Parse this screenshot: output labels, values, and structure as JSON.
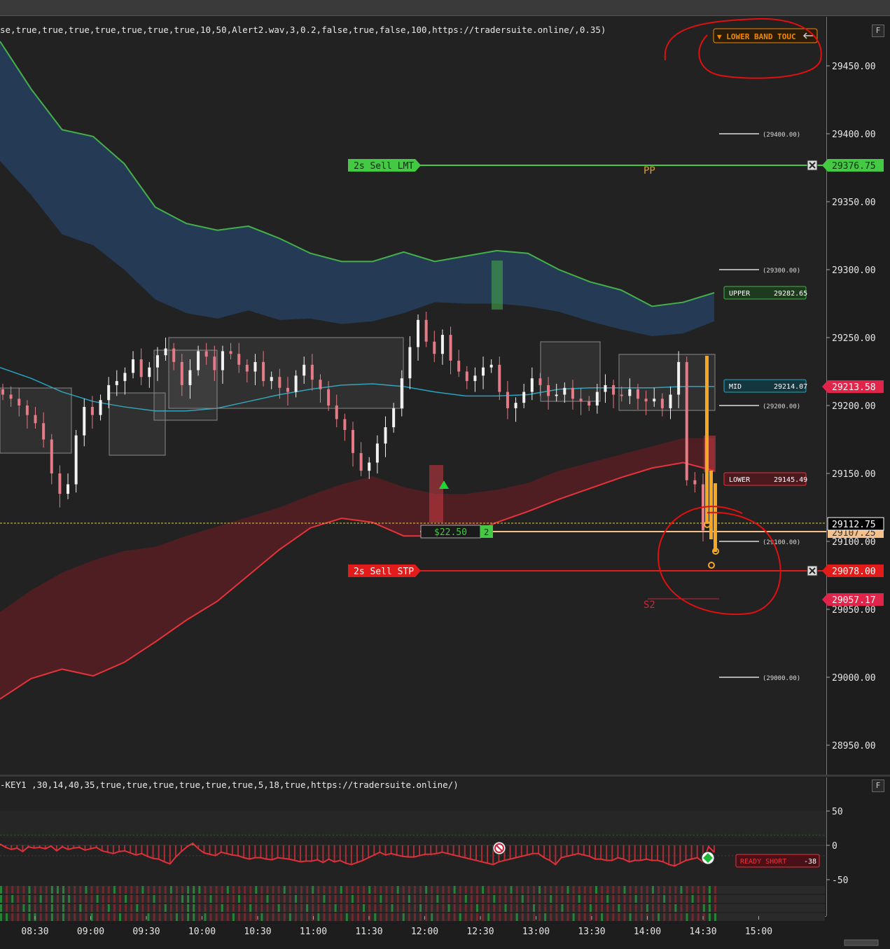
{
  "main_params": "se,true,true,true,true,true,true,true,10,50,Alert2.wav,3,0.2,false,true,false,100,https://tradersuite.online/,0.35)",
  "sub_params": "-KEY1 ,30,14,40,35,true,true,true,true,true,true,5,18,true,https://tradersuite.online/)",
  "f_label": "F",
  "alert_badge": "▼ LOWER BAND TOUC",
  "orders": {
    "sell_limit": {
      "label": "2s Sell LMT",
      "price": "29376.75"
    },
    "sell_stop": {
      "label": "2s Sell STP",
      "price": "29078.00"
    },
    "position_pnl": "$22.50",
    "position_qty": "2"
  },
  "bands": {
    "upper": {
      "label": "UPPER",
      "value": "29282.65"
    },
    "mid": {
      "label": "MID",
      "value": "29214.07"
    },
    "lower": {
      "label": "LOWER",
      "value": "29145.49"
    }
  },
  "price_flags": {
    "last": "29112.75",
    "entry": "29107.25",
    "mid_price": "29213.58",
    "s2_price": "29057.17"
  },
  "pivots": {
    "pp": "PP",
    "s2": "S2"
  },
  "ready_short": {
    "label": "READY SHORT",
    "value": "-38"
  },
  "colors": {
    "up_band": "#45b04a",
    "mid": "#25a5c0",
    "low_band": "#e8333a",
    "sell_stop": "#e21b1b",
    "sell_lmt": "#43c943",
    "entry": "#f5c08a",
    "alert": "#f08a00",
    "annot": "#e01010"
  },
  "chart_data": {
    "type": "candlestick",
    "x_ticks": [
      "08:30",
      "09:00",
      "09:30",
      "10:00",
      "10:30",
      "11:00",
      "11:30",
      "12:00",
      "12:30",
      "13:00",
      "13:30",
      "14:00",
      "14:30",
      "15:00"
    ],
    "y_ticks": [
      "29450.00",
      "29400.00",
      "29350.00",
      "29300.00",
      "29250.00",
      "29200.00",
      "29150.00",
      "29100.00",
      "29050.00",
      "29000.00",
      "28950.00"
    ],
    "ylim": [
      28926,
      29484
    ],
    "round_levels": [
      "(29400.00)",
      "(29300.00)",
      "(29200.00)",
      "(29100.00)",
      "(29000.00)"
    ],
    "sub_y_ticks": [
      "50",
      "0",
      "-50"
    ],
    "sub_ylim": [
      -72,
      72
    ],
    "upper_band": [
      [
        0,
        29468
      ],
      [
        1,
        29433
      ],
      [
        2,
        29403
      ],
      [
        3,
        29398
      ],
      [
        4,
        29378
      ],
      [
        5,
        29346
      ],
      [
        6,
        29334
      ],
      [
        7,
        29329
      ],
      [
        8,
        29332
      ],
      [
        9,
        29323
      ],
      [
        10,
        29312
      ],
      [
        11,
        29306
      ],
      [
        12,
        29306
      ],
      [
        13,
        29313
      ],
      [
        14,
        29306
      ],
      [
        15,
        29310
      ],
      [
        16,
        29314
      ],
      [
        17,
        29312
      ],
      [
        18,
        29300
      ],
      [
        19,
        29291
      ],
      [
        20,
        29285
      ],
      [
        21,
        29273
      ],
      [
        22,
        29276
      ],
      [
        23,
        29283
      ]
    ],
    "upper_band_outer": [
      [
        0,
        29380
      ],
      [
        1,
        29355
      ],
      [
        2,
        29326
      ],
      [
        3,
        29318
      ],
      [
        4,
        29300
      ],
      [
        5,
        29278
      ],
      [
        6,
        29268
      ],
      [
        7,
        29264
      ],
      [
        8,
        29270
      ],
      [
        9,
        29263
      ],
      [
        10,
        29264
      ],
      [
        11,
        29260
      ],
      [
        12,
        29262
      ],
      [
        13,
        29268
      ],
      [
        14,
        29276
      ],
      [
        15,
        29275
      ],
      [
        16,
        29275
      ],
      [
        17,
        29273
      ],
      [
        18,
        29269
      ],
      [
        19,
        29262
      ],
      [
        20,
        29256
      ],
      [
        21,
        29251
      ],
      [
        22,
        29253
      ],
      [
        23,
        29262
      ]
    ],
    "mid_line": [
      [
        0,
        29228
      ],
      [
        1,
        29220
      ],
      [
        2,
        29210
      ],
      [
        3,
        29203
      ],
      [
        4,
        29199
      ],
      [
        5,
        29196
      ],
      [
        6,
        29196
      ],
      [
        7,
        29198
      ],
      [
        8,
        29203
      ],
      [
        9,
        29208
      ],
      [
        10,
        29212
      ],
      [
        11,
        29215
      ],
      [
        12,
        29216
      ],
      [
        13,
        29214
      ],
      [
        14,
        29210
      ],
      [
        15,
        29207
      ],
      [
        16,
        29207
      ],
      [
        17,
        29208
      ],
      [
        18,
        29212
      ],
      [
        19,
        29213
      ],
      [
        20,
        29213
      ],
      [
        21,
        29213
      ],
      [
        22,
        29214
      ],
      [
        23,
        29214
      ]
    ],
    "lower_band_outer": [
      [
        0,
        29048
      ],
      [
        1,
        29064
      ],
      [
        2,
        29077
      ],
      [
        3,
        29086
      ],
      [
        4,
        29093
      ],
      [
        5,
        29096
      ],
      [
        6,
        29104
      ],
      [
        7,
        29111
      ],
      [
        8,
        29118
      ],
      [
        9,
        29125
      ],
      [
        10,
        29134
      ],
      [
        11,
        29142
      ],
      [
        12,
        29148
      ],
      [
        13,
        29140
      ],
      [
        14,
        29135
      ],
      [
        15,
        29135
      ],
      [
        16,
        29138
      ],
      [
        17,
        29143
      ],
      [
        18,
        29152
      ],
      [
        19,
        29158
      ],
      [
        20,
        29164
      ],
      [
        21,
        29170
      ],
      [
        22,
        29176
      ],
      [
        23,
        29176
      ]
    ],
    "lower_band": [
      [
        0,
        28984
      ],
      [
        1,
        28999
      ],
      [
        2,
        29006
      ],
      [
        3,
        29001
      ],
      [
        4,
        29011
      ],
      [
        5,
        29026
      ],
      [
        6,
        29042
      ],
      [
        7,
        29056
      ],
      [
        8,
        29075
      ],
      [
        9,
        29094
      ],
      [
        10,
        29110
      ],
      [
        11,
        29117
      ],
      [
        12,
        29114
      ],
      [
        13,
        29104
      ],
      [
        14,
        29104
      ],
      [
        15,
        29104
      ],
      [
        16,
        29114
      ],
      [
        17,
        29122
      ],
      [
        18,
        29131
      ],
      [
        19,
        29139
      ],
      [
        20,
        29147
      ],
      [
        21,
        29154
      ],
      [
        22,
        29158
      ],
      [
        23,
        29152
      ]
    ],
    "candles_close": [
      29208,
      29205,
      29200,
      29193,
      29187,
      29175,
      29150,
      29135,
      29142,
      29178,
      29199,
      29193,
      29204,
      29215,
      29218,
      29224,
      29234,
      29221,
      29228,
      29237,
      29242,
      29232,
      29215,
      29226,
      29240,
      29236,
      29226,
      29240,
      29238,
      29230,
      29225,
      29232,
      29218,
      29221,
      29213,
      29210,
      29222,
      29230,
      29219,
      29212,
      29200,
      29190,
      29182,
      29165,
      29152,
      29158,
      29172,
      29184,
      29198,
      29220,
      29243,
      29263,
      29247,
      29238,
      29252,
      29233,
      29225,
      29218,
      29222,
      29228,
      29230,
      29210,
      29198,
      29202,
      29210,
      29220,
      29215,
      29207,
      29208,
      29213,
      29205,
      29203,
      29200,
      29210,
      29215,
      29208,
      29207,
      29212,
      29205,
      29203,
      29205,
      29198,
      29208,
      29232,
      29145,
      29142,
      29108
    ],
    "oscillator": [
      2,
      -3,
      -6,
      -4,
      -9,
      -2,
      -4,
      -3,
      -5,
      -1,
      -8,
      -2,
      -6,
      -4,
      -3,
      -7,
      -5,
      -3,
      -8,
      -10,
      -12,
      -9,
      -8,
      -11,
      -14,
      -12,
      -16,
      -19,
      -20,
      -24,
      -27,
      -17,
      -9,
      -2,
      3,
      -5,
      -11,
      -13,
      -15,
      -10,
      -12,
      -14,
      -15,
      -18,
      -20,
      -18,
      -18,
      -20,
      -21,
      -18,
      -19,
      -20,
      -22,
      -24,
      -23,
      -23,
      -21,
      -25,
      -20,
      -24,
      -22,
      -26,
      -28,
      -25,
      -22,
      -18,
      -14,
      -10,
      -14,
      -12,
      -14,
      -16,
      -17,
      -17,
      -15,
      -13,
      -13,
      -12,
      -10,
      -12,
      -14,
      -16,
      -18,
      -20,
      -22,
      -24,
      -26,
      -28,
      -24,
      -22,
      -20,
      -18,
      -16,
      -14,
      -12,
      -12,
      -18,
      -22,
      -28,
      -18,
      -16,
      -14,
      -12,
      -14,
      -16,
      -20,
      -20,
      -22,
      -22,
      -18,
      -20,
      -24,
      -22,
      -22,
      -20,
      -22,
      -22,
      -24,
      -28,
      -30,
      -26,
      -22,
      -20,
      -18,
      -24,
      -2,
      -10
    ]
  }
}
